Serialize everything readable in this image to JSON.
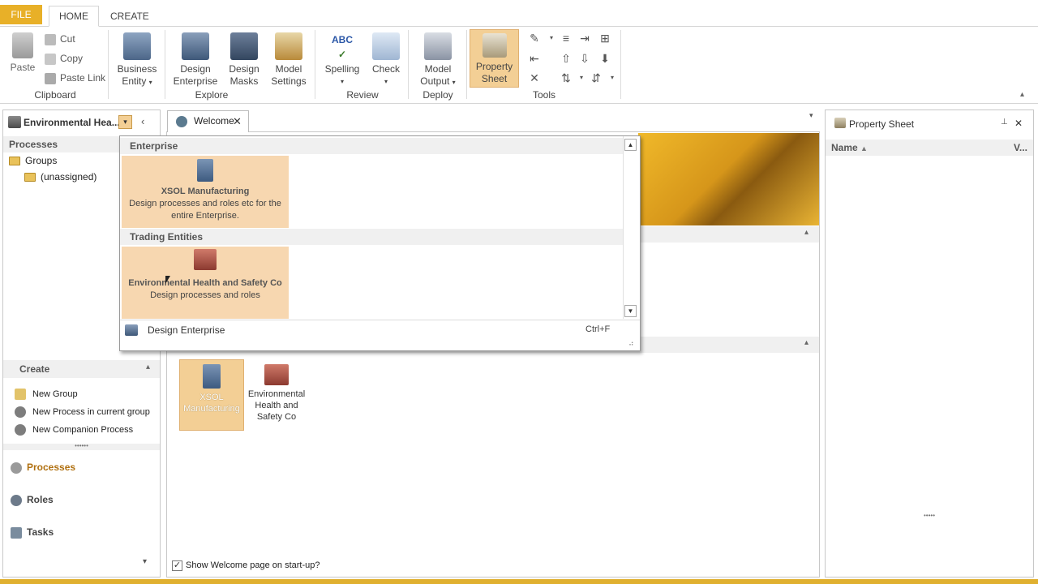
{
  "tabs": {
    "file": "FILE",
    "home": "HOME",
    "create": "CREATE"
  },
  "ribbon": {
    "clipboard": {
      "label": "Clipboard",
      "paste": "Paste",
      "cut": "Cut",
      "copy": "Copy",
      "paste_link": "Paste Link"
    },
    "explore": {
      "label": "Explore",
      "business_entity_1": "Business",
      "business_entity_2": "Entity",
      "design_enterprise_1": "Design",
      "design_enterprise_2": "Enterprise",
      "design_masks_1": "Design",
      "design_masks_2": "Masks",
      "model_settings_1": "Model",
      "model_settings_2": "Settings"
    },
    "review": {
      "label": "Review",
      "spelling": "Spelling",
      "check": "Check"
    },
    "deploy": {
      "label": "Deploy",
      "model_output_1": "Model",
      "model_output_2": "Output"
    },
    "tools": {
      "label": "Tools",
      "property_sheet_1": "Property",
      "property_sheet_2": "Sheet"
    }
  },
  "left": {
    "selector": "Environmental Hea...",
    "processes_header": "Processes",
    "tree": {
      "groups": "Groups",
      "unassigned": "(unassigned)"
    },
    "create_header": "Create",
    "create_items": [
      "New Group",
      "New Process in current group",
      "New Companion Process"
    ],
    "nav": {
      "processes": "Processes",
      "roles": "Roles",
      "tasks": "Tasks"
    }
  },
  "center": {
    "doc_tab": "Welcome",
    "tiles": [
      {
        "label1": "XSOL",
        "label2": "Manufacturing"
      },
      {
        "label1": "Environmental",
        "label2": "Health and",
        "label3": "Safety Co"
      }
    ],
    "show_welcome": "Show Welcome page on start-up?"
  },
  "dropdown": {
    "enterprise_header": "Enterprise",
    "enterprise_item": {
      "title": "XSOL Manufacturing",
      "desc1": "Design processes and roles etc for the",
      "desc2": "entire Enterprise."
    },
    "trading_header": "Trading Entities",
    "trading_item": {
      "title": "Environmental Health and Safety Co",
      "desc": "Design processes and roles"
    },
    "footer": {
      "label": "Design Enterprise",
      "shortcut": "Ctrl+F"
    }
  },
  "right": {
    "title": "Property Sheet",
    "col_name": "Name",
    "col_value": "V..."
  },
  "colors": {
    "accent": "#e8b028",
    "highlight": "#f7d7b0"
  }
}
